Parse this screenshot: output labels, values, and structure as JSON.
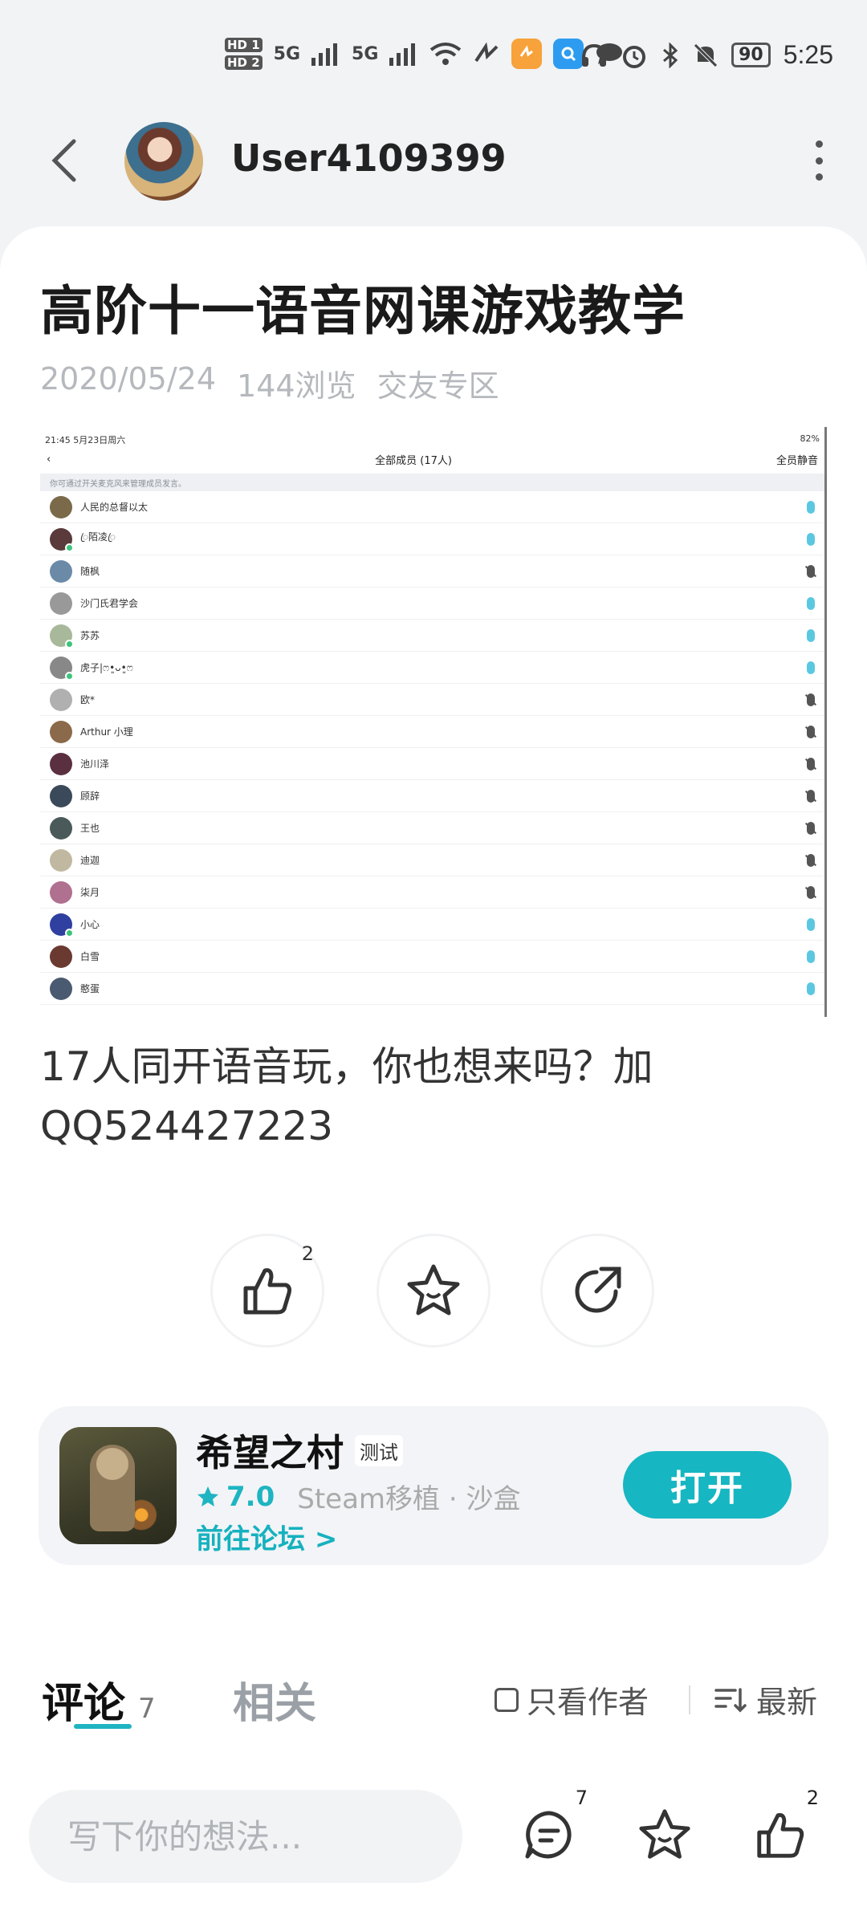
{
  "status_bar": {
    "time": "5:25",
    "battery": "90",
    "network": [
      "5G",
      "5G"
    ],
    "hd_labels": [
      "HD 1",
      "HD 2"
    ],
    "icons": [
      "signal-icon",
      "wifi-icon",
      "nfc-icon",
      "app-badge-icon",
      "search-app-icon",
      "message-icon",
      "headset-icon",
      "alarm-icon",
      "bluetooth-icon",
      "mute-icon",
      "battery-icon"
    ]
  },
  "header": {
    "username": "User4109399",
    "back_icon": "chevron-left-icon",
    "more_icon": "more-vertical-icon"
  },
  "post": {
    "title": "高阶十一语音网课游戏教学",
    "date": "2020/05/24",
    "views": "144浏览",
    "category": "交友专区",
    "body_line1": "17人同开语音玩，你也想来吗？加",
    "body_line2": "QQ524427223"
  },
  "screenshot": {
    "status_left": "21:45  5月23日周六",
    "status_right": "82%",
    "nav_title": "全部成员 (17人)",
    "nav_right": "全员静音",
    "tip": "你可通过开关麦克风来管理成员发言。",
    "members": [
      {
        "name": "人民的总督以太",
        "mic": "on",
        "color": "#7a6a4a",
        "online": false
      },
      {
        "name": "ꦿ陌凌ꦿ",
        "mic": "on",
        "color": "#5a3a3a",
        "online": true
      },
      {
        "name": "随枫",
        "mic": "off",
        "color": "#6a8aa8",
        "online": false
      },
      {
        "name": "沙门氏君学会",
        "mic": "on",
        "color": "#999999",
        "online": false
      },
      {
        "name": "苏苏",
        "mic": "on",
        "color": "#a8b89a",
        "online": true
      },
      {
        "name": "虎子|ෆ•͈ᴗ•͈ෆ",
        "mic": "on",
        "color": "#888888",
        "online": true
      },
      {
        "name": "欧*",
        "mic": "off",
        "color": "#b0b0b0",
        "online": false
      },
      {
        "name": "Arthur 小理",
        "mic": "off",
        "color": "#8a6a4a",
        "online": false
      },
      {
        "name": "池川泽",
        "mic": "off",
        "color": "#5a3040",
        "online": false
      },
      {
        "name": "顾辞",
        "mic": "off",
        "color": "#3a4a5a",
        "online": false
      },
      {
        "name": "王也",
        "mic": "off",
        "color": "#4a5a5a",
        "online": false
      },
      {
        "name": "迪迦",
        "mic": "off",
        "color": "#c0b8a0",
        "online": false
      },
      {
        "name": "柒月",
        "mic": "off",
        "color": "#b07090",
        "online": false
      },
      {
        "name": "小心",
        "mic": "on",
        "color": "#3040a0",
        "online": true
      },
      {
        "name": "白雪",
        "mic": "on",
        "color": "#6a3a30",
        "online": false
      },
      {
        "name": "憨蛋",
        "mic": "on",
        "color": "#4a5a70",
        "online": false
      }
    ]
  },
  "actions": {
    "like_count": "2",
    "like_icon": "thumbs-up-icon",
    "favorite_icon": "star-icon",
    "share_icon": "share-icon"
  },
  "game": {
    "name": "希望之村",
    "tag": "测试",
    "score": "7.0",
    "categories": "Steam移植 · 沙盒",
    "forum_link": "前往论坛 >",
    "open_label": "打开",
    "accent_color": "#16b6c2"
  },
  "tabs": {
    "comment_label": "评论",
    "comment_count": "7",
    "related_label": "相关",
    "author_only": "只看作者",
    "sort_label": "最新"
  },
  "bottom_bar": {
    "placeholder": "写下你的想法...",
    "comment_count": "7",
    "like_count": "2"
  }
}
